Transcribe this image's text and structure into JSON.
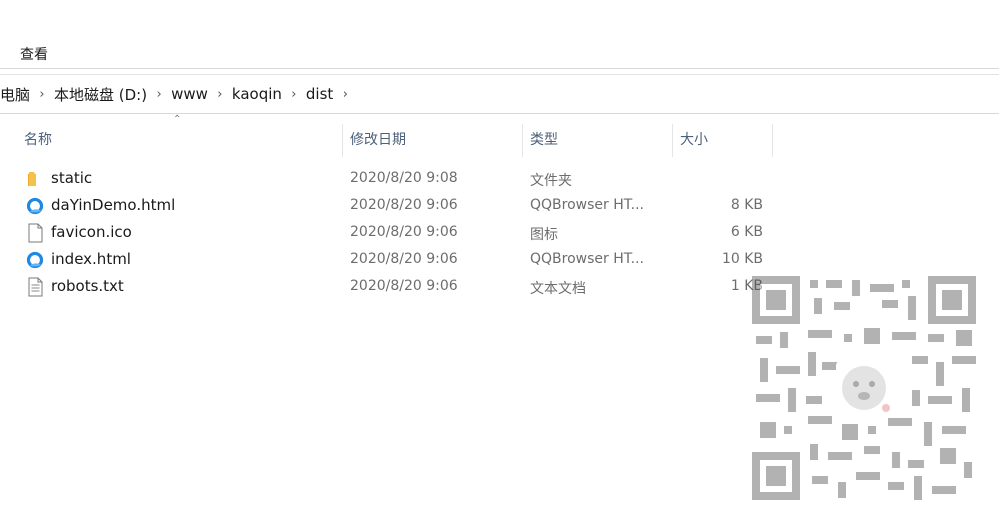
{
  "ribbon": {
    "view_tab": "查看"
  },
  "breadcrumb": [
    "电脑",
    "本地磁盘 (D:)",
    "www",
    "kaoqin",
    "dist"
  ],
  "breadcrumb_separator": "›",
  "columns": {
    "name": "名称",
    "modified": "修改日期",
    "type": "类型",
    "size": "大小"
  },
  "files": [
    {
      "icon": "folder-icon",
      "name": "static",
      "modified": "2020/8/20 9:08",
      "type": "文件夹",
      "size": ""
    },
    {
      "icon": "qqbrowser-icon",
      "name": "daYinDemo.html",
      "modified": "2020/8/20 9:06",
      "type": "QQBrowser HT...",
      "size": "8 KB"
    },
    {
      "icon": "generic-file-icon",
      "name": "favicon.ico",
      "modified": "2020/8/20 9:06",
      "type": "图标",
      "size": "6 KB"
    },
    {
      "icon": "qqbrowser-icon",
      "name": "index.html",
      "modified": "2020/8/20 9:06",
      "type": "QQBrowser HT...",
      "size": "10 KB"
    },
    {
      "icon": "text-file-icon",
      "name": "robots.txt",
      "modified": "2020/8/20 9:06",
      "type": "文本文档",
      "size": "1 KB"
    }
  ],
  "colors": {
    "header_text": "#4c607a",
    "folder": "#f3c24b",
    "qqbrowser": "#1e88e5"
  }
}
